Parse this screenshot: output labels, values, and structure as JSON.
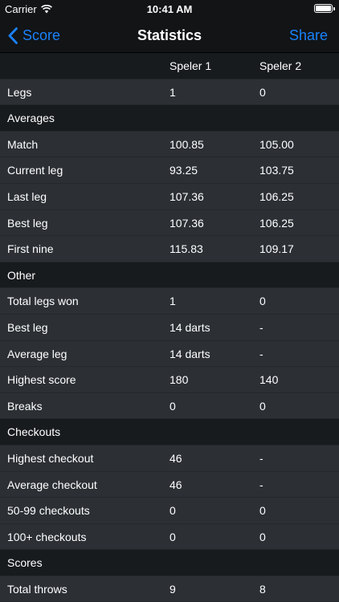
{
  "status_bar": {
    "carrier": "Carrier",
    "time": "10:41 AM"
  },
  "nav": {
    "back_label": "Score",
    "title": "Statistics",
    "share_label": "Share"
  },
  "table": {
    "columns": [
      "",
      "Speler 1",
      "Speler 2"
    ],
    "rows": [
      {
        "type": "data",
        "label": "Legs",
        "p1": "1",
        "p2": "0"
      },
      {
        "type": "section",
        "label": "Averages"
      },
      {
        "type": "data",
        "label": "Match",
        "p1": "100.85",
        "p2": "105.00"
      },
      {
        "type": "data",
        "label": "Current leg",
        "p1": "93.25",
        "p2": "103.75"
      },
      {
        "type": "data",
        "label": "Last leg",
        "p1": "107.36",
        "p2": "106.25"
      },
      {
        "type": "data",
        "label": "Best leg",
        "p1": "107.36",
        "p2": "106.25"
      },
      {
        "type": "data",
        "label": "First nine",
        "p1": "115.83",
        "p2": "109.17"
      },
      {
        "type": "section",
        "label": "Other"
      },
      {
        "type": "data",
        "label": "Total legs won",
        "p1": "1",
        "p2": "0"
      },
      {
        "type": "data",
        "label": "Best leg",
        "p1": "14 darts",
        "p2": "-"
      },
      {
        "type": "data",
        "label": "Average leg",
        "p1": "14 darts",
        "p2": "-"
      },
      {
        "type": "data",
        "label": "Highest score",
        "p1": "180",
        "p2": "140"
      },
      {
        "type": "data",
        "label": "Breaks",
        "p1": "0",
        "p2": "0"
      },
      {
        "type": "section",
        "label": "Checkouts"
      },
      {
        "type": "data",
        "label": "Highest checkout",
        "p1": "46",
        "p2": "-"
      },
      {
        "type": "data",
        "label": "Average checkout",
        "p1": "46",
        "p2": "-"
      },
      {
        "type": "data",
        "label": "50-99 checkouts",
        "p1": "0",
        "p2": "0"
      },
      {
        "type": "data",
        "label": "100+ checkouts",
        "p1": "0",
        "p2": "0"
      },
      {
        "type": "section",
        "label": "Scores"
      },
      {
        "type": "data",
        "label": "Total throws",
        "p1": "9",
        "p2": "8"
      }
    ]
  },
  "colors": {
    "accent": "#1a82fb",
    "row_bg": "#2c3035",
    "section_bg": "#181b1e",
    "bar_bg": "#121416"
  }
}
